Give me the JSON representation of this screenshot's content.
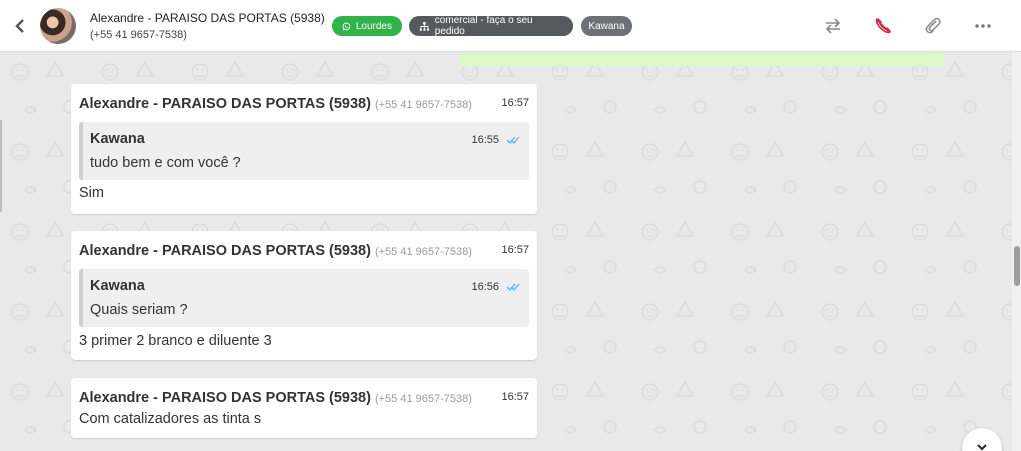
{
  "header": {
    "contact_name": "Alexandre - PARAISO DAS PORTAS (5938)",
    "contact_phone": "(+55 41 9657-7538)",
    "tags": {
      "agent": "Lourdes",
      "queue": "comercial - faça o seu pedido",
      "user": "Kawana"
    },
    "icons": [
      "back-icon",
      "whatsapp-icon",
      "sitemap-icon",
      "transfer-icon",
      "call-end-icon",
      "paperclip-icon",
      "more-icon"
    ]
  },
  "messages": [
    {
      "sender": "Alexandre - PARAISO DAS PORTAS (5938)",
      "phone": "(+55 41 9657-7538)",
      "time": "16:57",
      "quote": {
        "name": "Kawana",
        "time": "16:55",
        "text": "tudo bem e com você ?"
      },
      "text": "Sim"
    },
    {
      "sender": "Alexandre - PARAISO DAS PORTAS (5938)",
      "phone": "(+55 41 9657-7538)",
      "time": "16:57",
      "quote": {
        "name": "Kawana",
        "time": "16:56",
        "text": "Quais seriam ?"
      },
      "text": "3 primer 2 branco e diluente 3"
    },
    {
      "sender": "Alexandre - PARAISO DAS PORTAS (5938)",
      "phone": "(+55 41 9657-7538)",
      "time": "16:57",
      "text": "Com catalizadores as tinta s"
    }
  ],
  "colors": {
    "tag_green": "#32b34a",
    "tag_dark": "#555a5e",
    "tag_grey": "#6d7176",
    "call_end": "#d7263d",
    "read_check": "#4fb6ec",
    "outgoing_bubble": "#dcf8c6"
  }
}
